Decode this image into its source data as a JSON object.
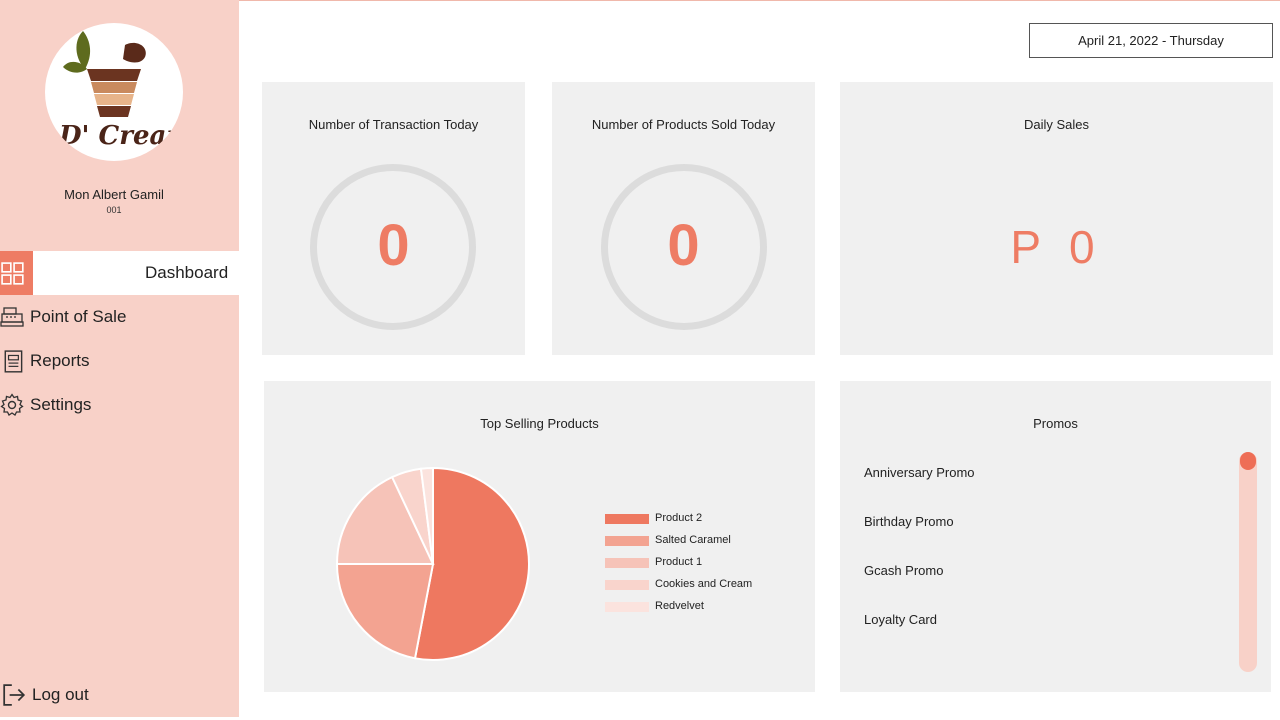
{
  "user": {
    "name": "Mon Albert Gamil",
    "id": "001",
    "logo_text": "D' Cream"
  },
  "nav": {
    "items": [
      {
        "label": "Dashboard",
        "icon": "dashboard-icon",
        "active": true
      },
      {
        "label": "Point of Sale",
        "icon": "cash-register-icon",
        "active": false
      },
      {
        "label": "Reports",
        "icon": "report-icon",
        "active": false
      },
      {
        "label": "Settings",
        "icon": "gear-icon",
        "active": false
      }
    ],
    "logout_label": "Log out"
  },
  "date": "April 21, 2022 - Thursday",
  "cards": {
    "transactions": {
      "title": "Number of Transaction Today",
      "value": "0"
    },
    "products_sold": {
      "title": "Number of Products Sold Today",
      "value": "0"
    },
    "daily_sales": {
      "title": "Daily Sales",
      "value": "P 0"
    }
  },
  "top_selling": {
    "title": "Top Selling Products"
  },
  "chart_data": {
    "type": "pie",
    "title": "Top Selling Products",
    "categories": [
      "Product 2",
      "Salted Caramel",
      "Product 1",
      "Cookies and Cream",
      "Redvelvet"
    ],
    "values": [
      53,
      22,
      18,
      5,
      2
    ],
    "colors": [
      "#ee7860",
      "#f3a391",
      "#f6c3b8",
      "#f9d4cc",
      "#fbe3de"
    ],
    "legend_position": "right"
  },
  "promos": {
    "title": "Promos",
    "items": [
      "Anniversary Promo",
      "Birthday Promo",
      "Gcash Promo",
      "Loyalty Card"
    ]
  },
  "colors": {
    "accent": "#ee7c64",
    "sidebar": "#f8d1c8",
    "card": "#f0f0f0"
  }
}
